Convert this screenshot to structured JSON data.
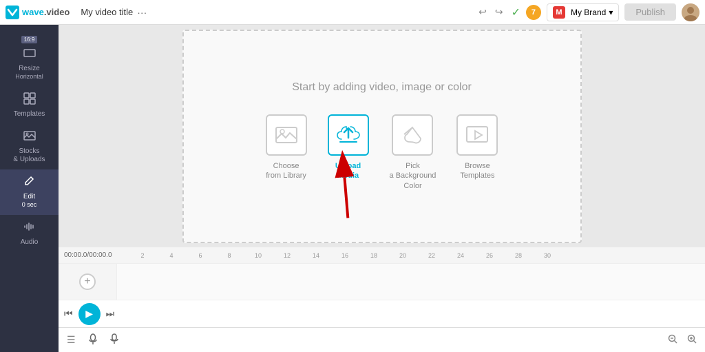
{
  "logo": {
    "text": "wave.video",
    "wave": "wave",
    "dot": ".",
    "video_part": "video"
  },
  "header": {
    "video_title": "My video title",
    "dots_label": "···",
    "timer": "7",
    "brand_label": "My Brand",
    "publish_label": "Publish"
  },
  "sidebar": {
    "items": [
      {
        "id": "resize",
        "icon": "⊞",
        "label": "Resize",
        "sublabel": "Horizontal",
        "badge": "16:9",
        "active": false
      },
      {
        "id": "templates",
        "icon": "▦",
        "label": "Templates",
        "active": false
      },
      {
        "id": "stocks",
        "icon": "🖼",
        "label": "Stocks\n& Uploads",
        "active": false
      },
      {
        "id": "edit",
        "icon": "✏",
        "label": "Edit",
        "sublabel": "0 sec",
        "active": true
      },
      {
        "id": "audio",
        "icon": "♪",
        "label": "Audio",
        "active": false
      }
    ]
  },
  "canvas": {
    "prompt": "Start by adding video, image or color",
    "actions": [
      {
        "id": "library",
        "label": "Choose\nfrom Library",
        "icon": "🖼",
        "highlighted": false
      },
      {
        "id": "upload",
        "label": "Upload\nMedia",
        "icon": "⬆",
        "highlighted": true
      },
      {
        "id": "bgcolor",
        "label": "Pick\na Background\nColor",
        "icon": "◇",
        "highlighted": false
      },
      {
        "id": "browse",
        "label": "Browse\nTemplates",
        "icon": "▷",
        "highlighted": false
      }
    ]
  },
  "timeline": {
    "time_display": "00:00.0/00:00.0",
    "ruler_marks": [
      "2",
      "4",
      "6",
      "8",
      "10",
      "12",
      "14",
      "16",
      "18",
      "20",
      "22",
      "24",
      "26",
      "28",
      "30"
    ]
  },
  "playback": {
    "skip_back": "⏮",
    "play": "▶",
    "skip_fwd": "⏭"
  },
  "bottom": {
    "menu_icon": "☰",
    "person_icon": "👤",
    "mic_icon": "🎤",
    "zoom_out": "🔍",
    "zoom_in": "🔍"
  }
}
